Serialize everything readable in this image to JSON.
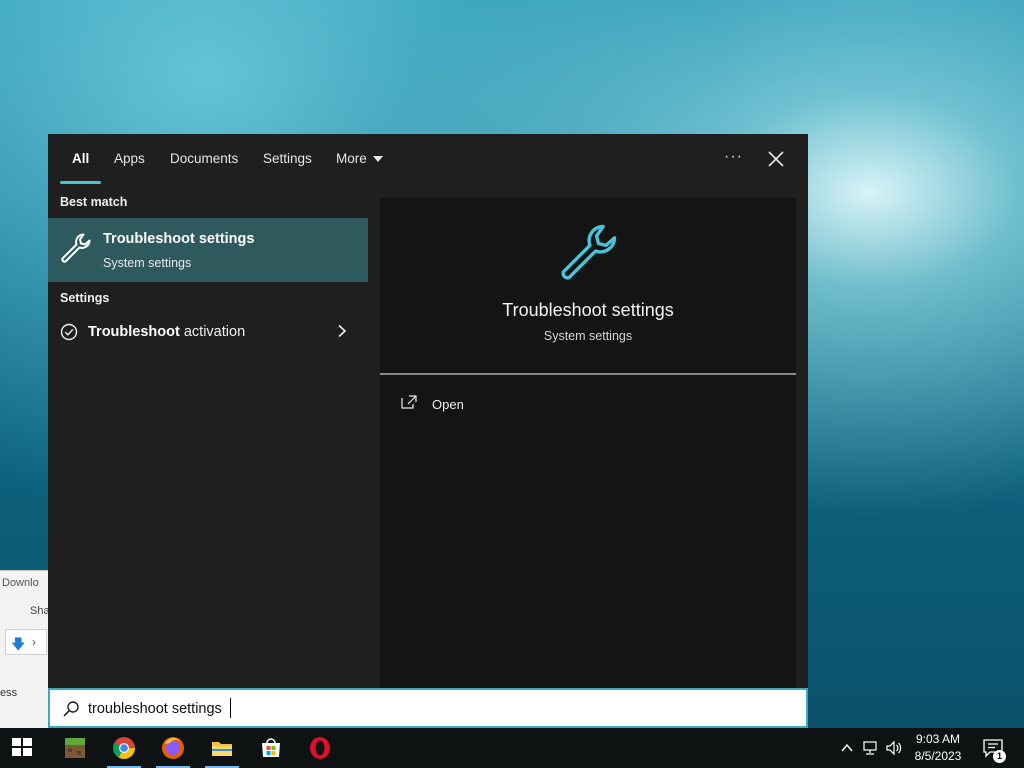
{
  "tabs": [
    {
      "label": "All"
    },
    {
      "label": "Apps"
    },
    {
      "label": "Documents"
    },
    {
      "label": "Settings"
    },
    {
      "label": "More"
    }
  ],
  "more_options_label": "···",
  "results": {
    "best_match_label": "Best match",
    "best_match": {
      "title": "Troubleshoot settings",
      "subtitle": "System settings",
      "icon": "wrench-icon"
    },
    "settings_label": "Settings",
    "settings_items": [
      {
        "bold": "Troubleshoot",
        "rest": " activation",
        "icon": "check-circle-icon"
      }
    ]
  },
  "preview": {
    "title": "Troubleshoot settings",
    "subtitle": "System settings",
    "actions": [
      {
        "label": "Open",
        "icon": "open-icon"
      }
    ]
  },
  "search": {
    "value": "troubleshoot settings",
    "icon": "search-icon"
  },
  "background_window": {
    "title_fragment": "Downlo",
    "tab_fragment": "Sha",
    "item_fragment": "ess"
  },
  "taskbar": {
    "apps": [
      "windows-start-icon",
      "minecraft-icon",
      "chrome-icon",
      "firefox-icon",
      "file-explorer-icon",
      "microsoft-store-icon",
      "opera-icon"
    ],
    "clock_time": "9:03 AM",
    "clock_date": "8/5/2023",
    "notification_count": "1"
  },
  "colors": {
    "accent": "#4cc2d6",
    "selection": "#2f5a5d",
    "panel": "#1f1f1f",
    "preview": "#141414"
  }
}
